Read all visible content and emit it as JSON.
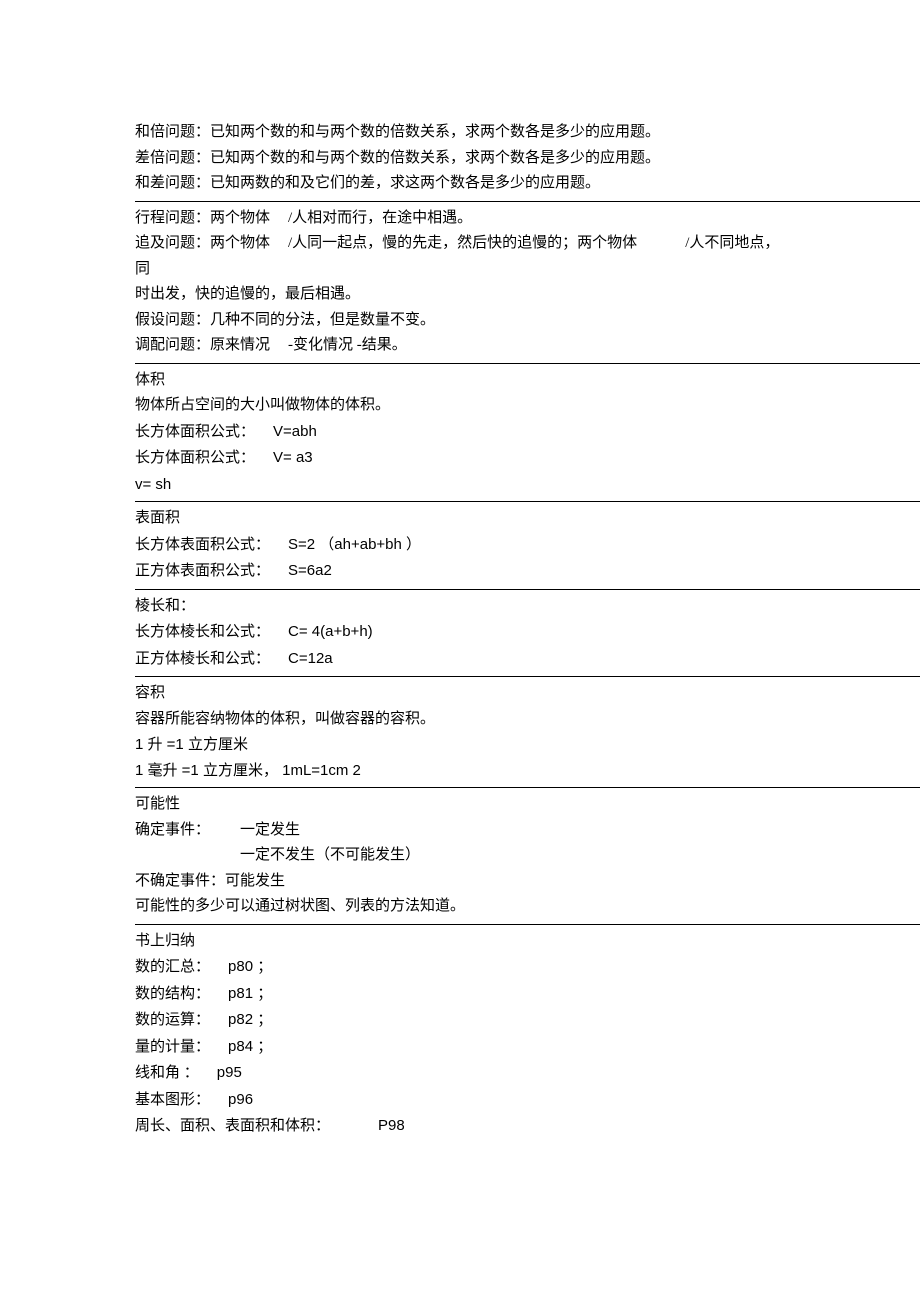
{
  "s1": {
    "l1": "和倍问题：已知两个数的和与两个数的倍数关系，求两个数各是多少的应用题。",
    "l2": "差倍问题：已知两个数的和与两个数的倍数关系，求两个数各是多少的应用题。",
    "l3": "和差问题：已知两数的和及它们的差，求这两个数各是多少的应用题。"
  },
  "s2": {
    "l1a": "行程问题：两个物体",
    "l1b": "/人相对而行，在途中相遇。",
    "l2a": "追及问题：两个物体",
    "l2b": "/人同一起点，慢的先走，然后快的追慢的；两个物体",
    "l2c": "/人不同地点，同",
    "l3": "时出发，快的追慢的，最后相遇。",
    "l4": "假设问题：几种不同的分法，但是数量不变。",
    "l5a": "调配问题：原来情况",
    "l5b": "-变化情况 -结果。"
  },
  "s3": {
    "h": "体积",
    "l1": "物体所占空间的大小叫做物体的体积。",
    "l2a": "长方体面积公式：",
    "l2b": "V=abh",
    "l3a": "长方体面积公式：",
    "l3b": "V= a3",
    "l4": "v= sh"
  },
  "s4": {
    "h": "表面积",
    "l1a": "长方体表面积公式：",
    "l1b": "S=2 （ah+ab+bh ）",
    "l2a": "正方体表面积公式：",
    "l2b": "S=6a2"
  },
  "s5": {
    "h": "棱长和：",
    "l1a": "长方体棱长和公式：",
    "l1b": "C= 4(a+b+h)",
    "l2a": "正方体棱长和公式：",
    "l2b": "C=12a"
  },
  "s6": {
    "h": "容积",
    "l1": "容器所能容纳物体的体积，叫做容器的容积。",
    "l2": "1 升 =1 立方厘米",
    "l3": "1 毫升 =1 立方厘米，   1mL=1cm 2"
  },
  "s7": {
    "h": "可能性",
    "l1a": "确定事件：",
    "l1b": "一定发生",
    "l2": "一定不发生（不可能发生）",
    "l3": "不确定事件：可能发生",
    "l4": "可能性的多少可以通过树状图、列表的方法知道。"
  },
  "s8": {
    "h": "书上归纳",
    "r1a": "数的汇总：",
    "r1b": "p80 ；",
    "r2a": "数的结构：",
    "r2b": "p81 ；",
    "r3a": "数的运算：",
    "r3b": "p82 ；",
    "r4a": "量的计量：",
    "r4b": "p84 ；",
    "r5a": "线和角  ：",
    "r5b": "p95",
    "r6a": "基本图形：",
    "r6b": "p96",
    "r7a": "周长、面积、表面积和体积：",
    "r7b": "P98"
  }
}
